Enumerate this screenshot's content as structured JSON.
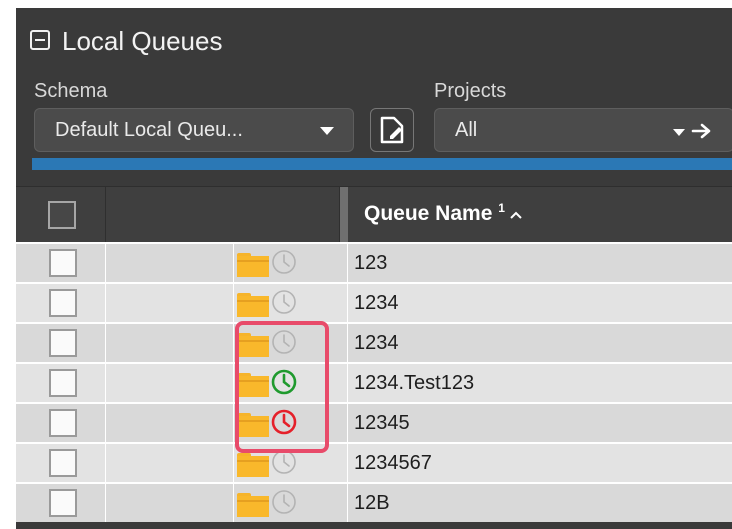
{
  "panel": {
    "title": "Local Queues"
  },
  "filters": {
    "schema_label": "Schema",
    "schema_value": "Default Local Queu...",
    "projects_label": "Projects",
    "projects_value": "All"
  },
  "table": {
    "header": {
      "queue_name": "Queue Name",
      "sort_index": "1"
    },
    "rows": [
      {
        "name": "123",
        "status": "inactive"
      },
      {
        "name": "1234",
        "status": "inactive"
      },
      {
        "name": "1234",
        "status": "inactive"
      },
      {
        "name": "1234.Test123",
        "status": "active"
      },
      {
        "name": "12345",
        "status": "error"
      },
      {
        "name": "1234567",
        "status": "inactive"
      },
      {
        "name": "12B",
        "status": "inactive"
      }
    ]
  },
  "colors": {
    "clock_inactive": "#b3b3b3",
    "clock_active": "#1f9a2e",
    "clock_error": "#e5202a",
    "highlight": "#e84b6a",
    "progress": "#2b78b5"
  },
  "icons": [
    "collapse-icon",
    "dropdown-caret-icon",
    "edit-schema-icon",
    "arrow-right-icon",
    "folder-icon",
    "clock-icon",
    "sort-ascending-icon"
  ]
}
